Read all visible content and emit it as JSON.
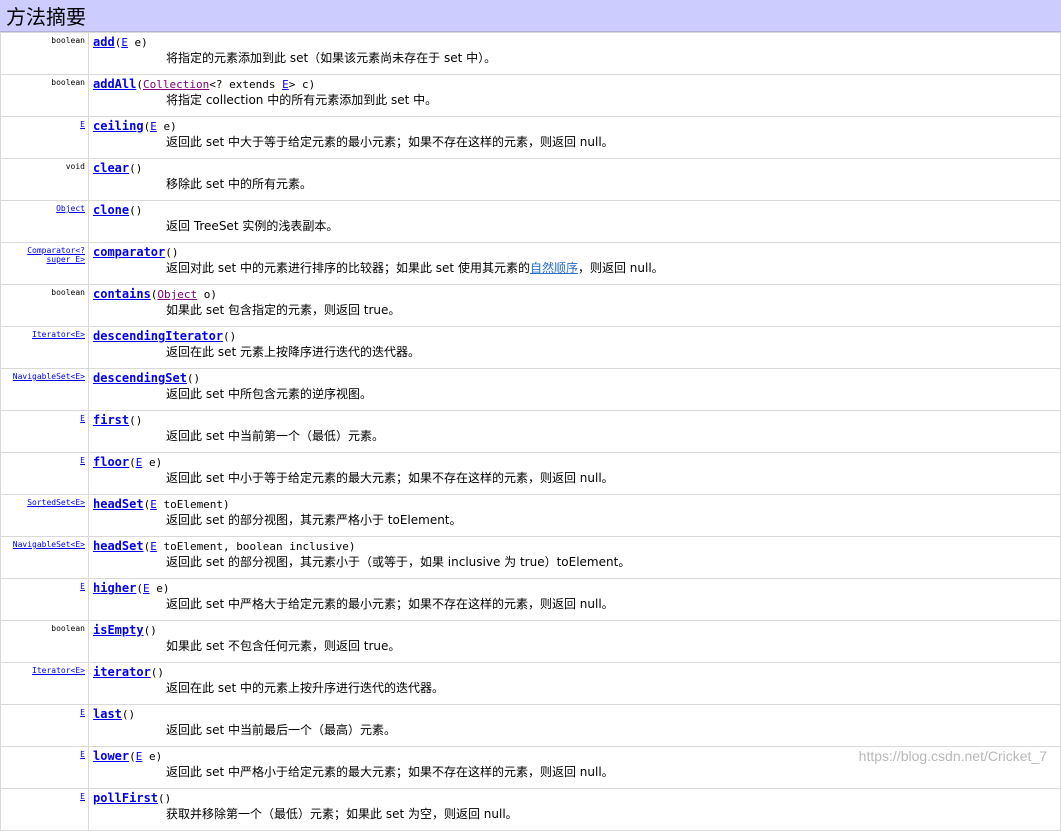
{
  "header": {
    "title": "方法摘要"
  },
  "watermark": "https://blog.csdn.net/Cricket_7",
  "rows": [
    {
      "ret": "boolean",
      "name": "add",
      "params": [
        {
          "t": "E"
        },
        {
          "s": " e)"
        }
      ],
      "desc": "将指定的元素添加到此 set（如果该元素尚未存在于 set 中）。"
    },
    {
      "ret": "boolean",
      "name": "addAll",
      "params": [
        {
          "t": "Collection"
        },
        {
          "s": "<? extends "
        },
        {
          "t": "E"
        },
        {
          "s": "> c)"
        }
      ],
      "desc": "将指定 collection 中的所有元素添加到此 set 中。"
    },
    {
      "ret": "E",
      "retLink": true,
      "name": "ceiling",
      "params": [
        {
          "t": "E"
        },
        {
          "s": " e)"
        }
      ],
      "desc": "返回此 set 中大于等于给定元素的最小元素；如果不存在这样的元素，则返回 null。"
    },
    {
      "ret": "void",
      "name": "clear",
      "params": [
        {
          "s": ")"
        }
      ],
      "desc": "移除此 set 中的所有元素。"
    },
    {
      "ret": "Object",
      "retLink": true,
      "name": "clone",
      "params": [
        {
          "s": ")"
        }
      ],
      "desc": "返回 TreeSet 实例的浅表副本。"
    },
    {
      "ret": "Comparator<? super E>",
      "retLink": true,
      "name": "comparator",
      "params": [
        {
          "s": ")"
        }
      ],
      "desc": "返回对此 set 中的元素进行排序的比较器；如果此 set 使用其元素的",
      "descLink": "自然顺序",
      "descTail": "，则返回 null。"
    },
    {
      "ret": "boolean",
      "name": "contains",
      "params": [
        {
          "t": "Object"
        },
        {
          "s": " o)"
        }
      ],
      "desc": "如果此 set 包含指定的元素，则返回 true。"
    },
    {
      "ret": "Iterator<E>",
      "retLink": true,
      "name": "descendingIterator",
      "params": [
        {
          "s": ")"
        }
      ],
      "desc": "返回在此 set 元素上按降序进行迭代的迭代器。"
    },
    {
      "ret": "NavigableSet<E>",
      "retLink": true,
      "name": "descendingSet",
      "params": [
        {
          "s": ")"
        }
      ],
      "desc": "返回此 set 中所包含元素的逆序视图。"
    },
    {
      "ret": "E",
      "retLink": true,
      "name": "first",
      "params": [
        {
          "s": ")"
        }
      ],
      "desc": "返回此 set 中当前第一个（最低）元素。"
    },
    {
      "ret": "E",
      "retLink": true,
      "name": "floor",
      "params": [
        {
          "t": "E"
        },
        {
          "s": " e)"
        }
      ],
      "desc": "返回此 set 中小于等于给定元素的最大元素；如果不存在这样的元素，则返回 null。"
    },
    {
      "ret": "SortedSet<E>",
      "retLink": true,
      "name": "headSet",
      "params": [
        {
          "t": "E"
        },
        {
          "s": " toElement)"
        }
      ],
      "desc": "返回此 set 的部分视图，其元素严格小于 toElement。"
    },
    {
      "ret": "NavigableSet<E>",
      "retLink": true,
      "name": "headSet",
      "params": [
        {
          "t": "E"
        },
        {
          "s": " toElement, boolean inclusive)"
        }
      ],
      "desc": "返回此 set 的部分视图，其元素小于（或等于，如果 inclusive 为 true）toElement。"
    },
    {
      "ret": "E",
      "retLink": true,
      "name": "higher",
      "params": [
        {
          "t": "E"
        },
        {
          "s": " e)"
        }
      ],
      "desc": "返回此 set 中严格大于给定元素的最小元素；如果不存在这样的元素，则返回 null。"
    },
    {
      "ret": "boolean",
      "name": "isEmpty",
      "params": [
        {
          "s": ")"
        }
      ],
      "desc": "如果此 set 不包含任何元素，则返回 true。"
    },
    {
      "ret": "Iterator<E>",
      "retLink": true,
      "name": "iterator",
      "params": [
        {
          "s": ")"
        }
      ],
      "desc": "返回在此 set 中的元素上按升序进行迭代的迭代器。"
    },
    {
      "ret": "E",
      "retLink": true,
      "name": "last",
      "params": [
        {
          "s": ")"
        }
      ],
      "desc": "返回此 set 中当前最后一个（最高）元素。"
    },
    {
      "ret": "E",
      "retLink": true,
      "name": "lower",
      "params": [
        {
          "t": "E"
        },
        {
          "s": " e)"
        }
      ],
      "desc": "返回此 set 中严格小于给定元素的最大元素；如果不存在这样的元素，则返回 null。"
    },
    {
      "ret": "E",
      "retLink": true,
      "name": "pollFirst",
      "params": [
        {
          "s": ")"
        }
      ],
      "desc": "获取并移除第一个（最低）元素；如果此 set 为空，则返回 null。"
    }
  ]
}
